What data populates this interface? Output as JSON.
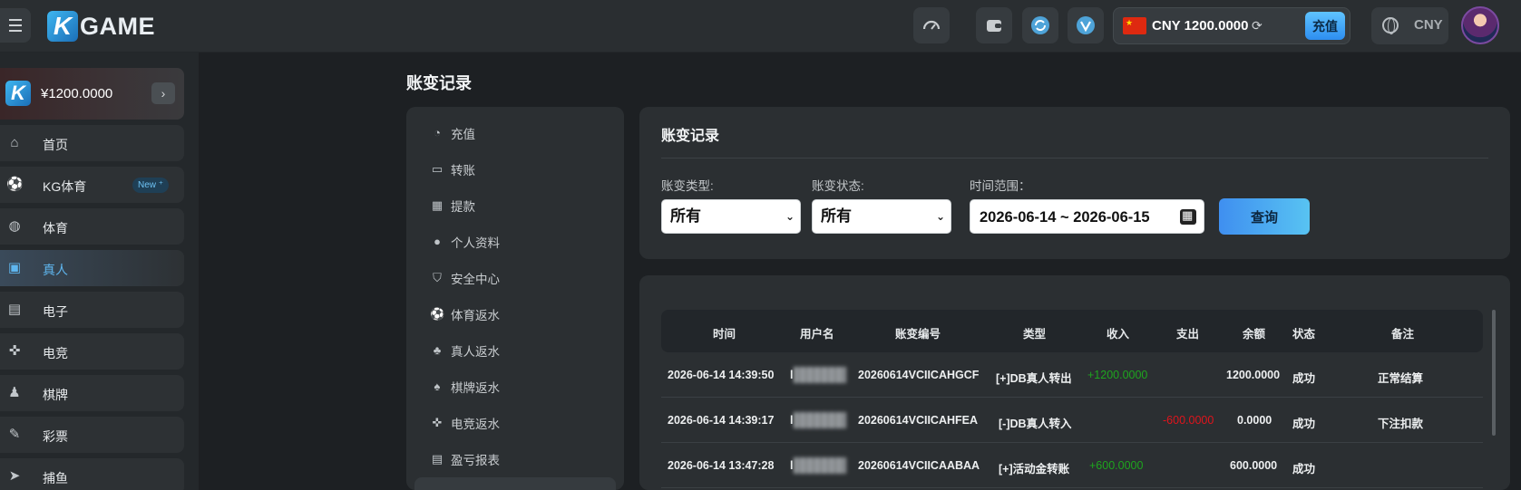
{
  "header": {
    "logo_k": "K",
    "logo_text": "GAME",
    "wallet_amount": "CNY 1200.0000",
    "deposit_label": "充值",
    "currency": "CNY"
  },
  "sidebar": {
    "balance": "¥1200.0000",
    "items": [
      {
        "label": "首页",
        "icon": "home-icon"
      },
      {
        "label": "KG体育",
        "icon": "soccer-ball-icon",
        "badge": "New ⁺"
      },
      {
        "label": "体育",
        "icon": "basketball-icon"
      },
      {
        "label": "真人",
        "icon": "cards-icon"
      },
      {
        "label": "电子",
        "icon": "slot-machine-icon"
      },
      {
        "label": "电竞",
        "icon": "gamepad-icon"
      },
      {
        "label": "棋牌",
        "icon": "chess-icon"
      },
      {
        "label": "彩票",
        "icon": "lottery-ticket-icon"
      },
      {
        "label": "捕鱼",
        "icon": "fish-icon"
      }
    ]
  },
  "page": {
    "title": "账变记录"
  },
  "submenu": {
    "items": [
      {
        "label": "充值",
        "icon": "deposit-icon"
      },
      {
        "label": "转账",
        "icon": "transfer-icon"
      },
      {
        "label": "提款",
        "icon": "withdraw-icon"
      },
      {
        "label": "个人资料",
        "icon": "user-icon"
      },
      {
        "label": "安全中心",
        "icon": "shield-icon"
      },
      {
        "label": "体育返水",
        "icon": "soccer-ball-icon"
      },
      {
        "label": "真人返水",
        "icon": "people-icon"
      },
      {
        "label": "棋牌返水",
        "icon": "poker-icon"
      },
      {
        "label": "电竞返水",
        "icon": "gamepad-icon"
      },
      {
        "label": "盈亏报表",
        "icon": "report-icon"
      }
    ]
  },
  "filter": {
    "title": "账变记录",
    "type_label": "账变类型:",
    "type_value": "所有",
    "status_label": "账变状态:",
    "status_value": "所有",
    "range_label": "时间范围：",
    "range_value": "2026-06-14 ~ 2026-06-15",
    "query_label": "查询"
  },
  "table": {
    "headers": [
      "时间",
      "用户名",
      "账变编号",
      "类型",
      "收入",
      "支出",
      "余额",
      "状态",
      "备注"
    ],
    "rows": [
      {
        "time": "2026-06-14 14:39:50",
        "user": "l",
        "id": "20260614VCIICAHGCF",
        "type": "[+]DB真人转出",
        "income": "+1200.0000",
        "expense": "",
        "balance": "1200.0000",
        "status": "成功",
        "note": "正常结算"
      },
      {
        "time": "2026-06-14 14:39:17",
        "user": "l",
        "id": "20260614VCIICAHFEA",
        "type": "[-]DB真人转入",
        "income": "",
        "expense": "-600.0000",
        "balance": "0.0000",
        "status": "成功",
        "note": "下注扣款"
      },
      {
        "time": "2026-06-14 13:47:28",
        "user": "l",
        "id": "20260614VCIICAABAA",
        "type": "[+]活动金转账",
        "income": "+600.0000",
        "expense": "",
        "balance": "600.0000",
        "status": "成功",
        "note": ""
      }
    ]
  },
  "colors": {
    "accent": "#5fb6ef",
    "income": "#1ea51e",
    "expense": "#e0141c"
  }
}
